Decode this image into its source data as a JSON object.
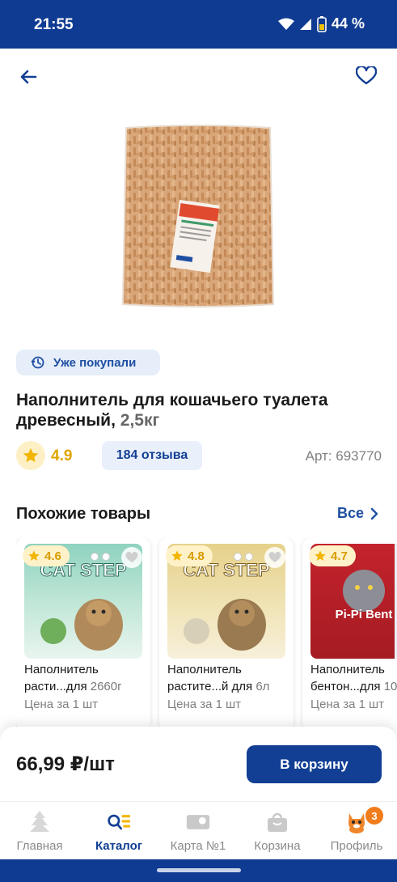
{
  "status": {
    "time": "21:55",
    "battery": "44 %"
  },
  "product": {
    "bought_badge": "Уже покупали",
    "title": "Наполнитель для кошачьего туалета древесный,",
    "weight": "2,5кг",
    "rating": "4.9",
    "reviews": "184 отзыва",
    "article": "Арт: 693770",
    "price": "66,99 ₽/шт",
    "add_to_cart": "В корзину"
  },
  "similar": {
    "title": "Похожие товары",
    "all_label": "Все",
    "items": [
      {
        "rating": "4.6",
        "line1": "Наполнитель",
        "line2": "расти...для",
        "extra": "2660г",
        "note": "Цена за 1 шт",
        "brand": "CAT STEP"
      },
      {
        "rating": "4.8",
        "line1": "Наполнитель",
        "line2": "растите...й для",
        "extra": "6л",
        "note": "Цена за 1 шт",
        "brand": "CAT STEP"
      },
      {
        "rating": "4.7",
        "line1": "Наполнитель",
        "line2": "бентон...для",
        "extra": "10",
        "note": "Цена за 1 шт",
        "brand": "Pi-Pi Bent"
      }
    ]
  },
  "tabs": [
    {
      "label": "Главная",
      "icon": "tree-icon"
    },
    {
      "label": "Каталог",
      "icon": "catalog-search-icon"
    },
    {
      "label": "Карта №1",
      "icon": "loyalty-card-icon"
    },
    {
      "label": "Корзина",
      "icon": "basket-icon"
    },
    {
      "label": "Профиль",
      "icon": "profile-cat-icon",
      "badge": "3"
    }
  ],
  "colors": {
    "brand": "#123f94",
    "status_bar": "#0f3b92",
    "rating": "#e0a400",
    "badge": "#f07c1b"
  }
}
